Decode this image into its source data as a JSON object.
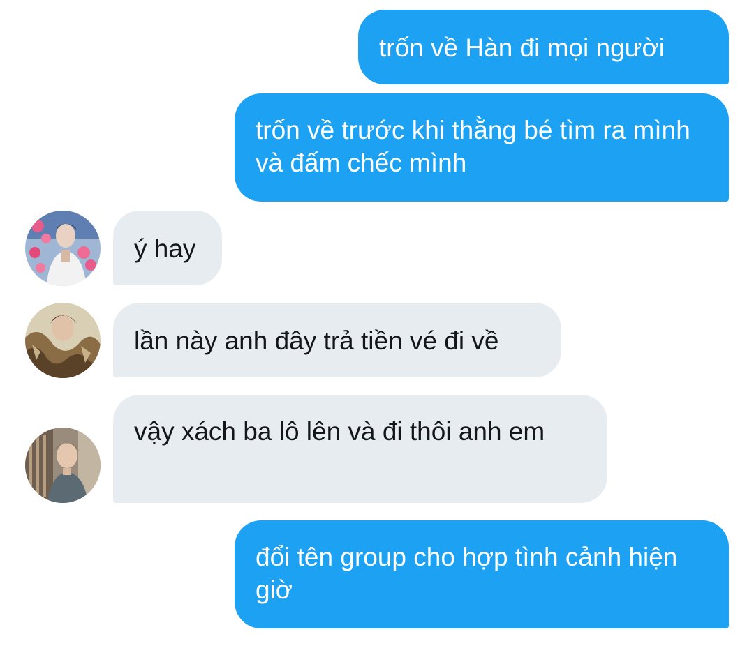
{
  "conversation": {
    "messages": [
      {
        "sender": "me",
        "text": "trốn về Hàn đi mọi người"
      },
      {
        "sender": "me",
        "text": "trốn về trước khi thằng bé tìm ra mình và đấm chếc mình"
      },
      {
        "sender": "other-1",
        "text": "ý hay"
      },
      {
        "sender": "other-2",
        "text": "lần này anh đây trả tiền vé đi về"
      },
      {
        "sender": "other-3",
        "text": "vậy xách ba lô lên và đi thôi anh em"
      },
      {
        "sender": "me",
        "text": "đổi tên group cho hợp tình cảnh hiện giờ"
      }
    ]
  },
  "colors": {
    "sent_bubble": "#1da1f2",
    "received_bubble": "#e6ecf0",
    "sent_text": "#ffffff",
    "received_text": "#14171a"
  }
}
